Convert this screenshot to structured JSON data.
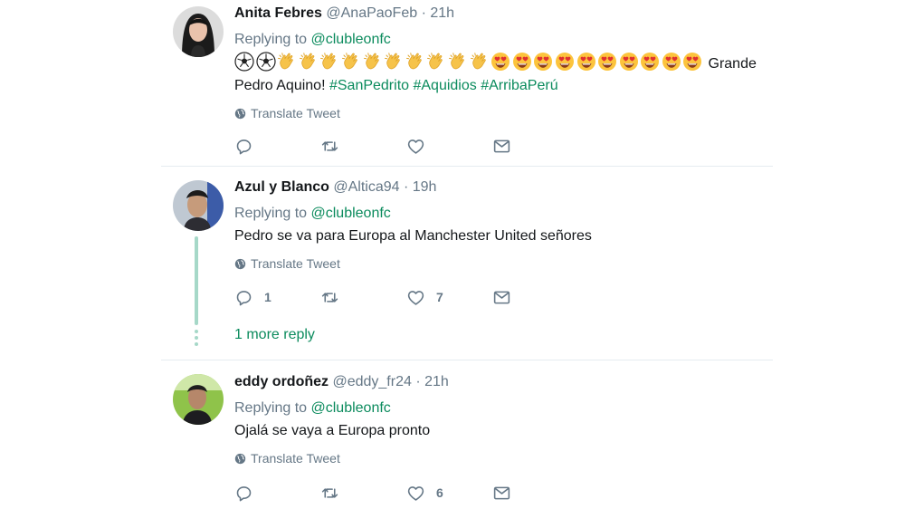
{
  "tweets": [
    {
      "name": "Anita Febres",
      "handle": "@AnaPaoFeb",
      "time": "· 21h",
      "replying_prefix": "Replying to ",
      "mention": "@clubleonfc",
      "text_end": " Grande Pedro Aquino! ",
      "hashtags": [
        "#SanPedrito",
        "#Aquidios",
        "#ArribaPerú"
      ],
      "emojis": [
        "soccer-ball",
        "soccer-ball",
        "clap",
        "clap",
        "clap",
        "clap",
        "clap",
        "clap",
        "clap",
        "clap",
        "clap",
        "clap",
        "heart-eyes",
        "heart-eyes",
        "heart-eyes",
        "heart-eyes",
        "heart-eyes",
        "heart-eyes",
        "heart-eyes",
        "heart-eyes",
        "heart-eyes",
        "heart-eyes"
      ],
      "translate": "Translate Tweet",
      "reply_count": "",
      "like_count": ""
    },
    {
      "name": "Azul y Blanco",
      "handle": "@Altica94",
      "time": "· 19h",
      "replying_prefix": "Replying to ",
      "mention": "@clubleonfc",
      "text": "Pedro se va para Europa al Manchester United señores",
      "translate": "Translate Tweet",
      "reply_count": "1",
      "like_count": "7",
      "more_replies": "1 more reply"
    },
    {
      "name": "eddy ordoñez",
      "handle": "@eddy_fr24",
      "time": "· 21h",
      "replying_prefix": "Replying to ",
      "mention": "@clubleonfc",
      "text": "Ojalá se vaya a Europa pronto",
      "translate": "Translate Tweet",
      "reply_count": "",
      "like_count": "6"
    }
  ],
  "colors": {
    "accent": "#0b8b5d",
    "muted": "#657786",
    "thread_line": "#a6d8c8",
    "divider": "#e6ecf0"
  },
  "icons": {
    "reply": "reply-icon",
    "retweet": "retweet-icon",
    "like": "heart-icon",
    "dm": "envelope-icon",
    "translate": "globe-icon"
  }
}
